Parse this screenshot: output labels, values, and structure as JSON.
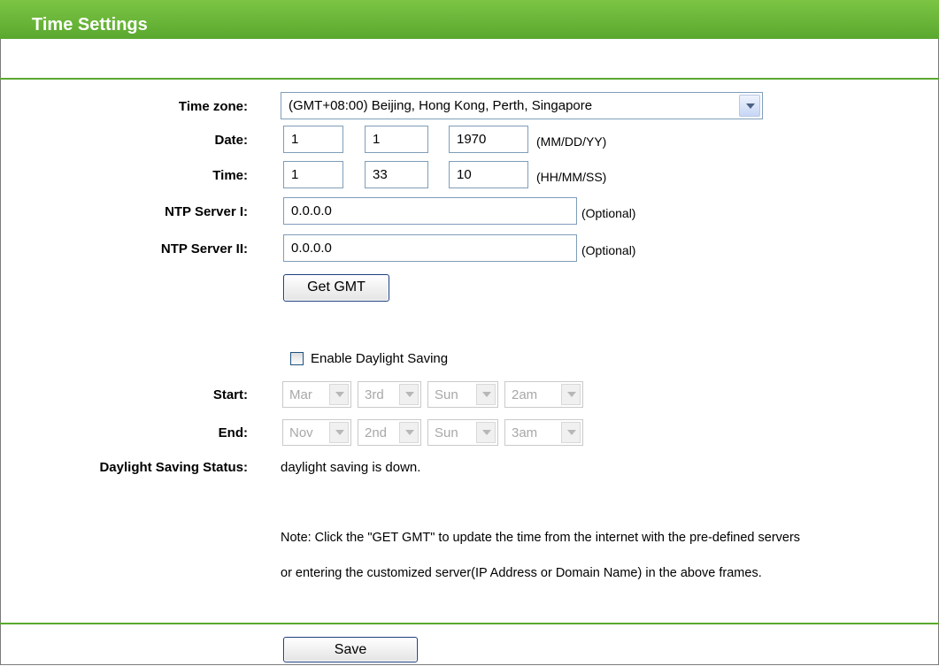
{
  "title": "Time Settings",
  "labels": {
    "time_zone": "Time zone:",
    "date": "Date:",
    "time": "Time:",
    "ntp1": "NTP Server I:",
    "ntp2": "NTP Server II:",
    "start": "Start:",
    "end": "End:",
    "dst_status": "Daylight Saving Status:"
  },
  "time_zone": {
    "selected": "(GMT+08:00) Beijing, Hong Kong, Perth, Singapore"
  },
  "date": {
    "month": "1",
    "day": "1",
    "year": "1970",
    "format": "(MM/DD/YY)"
  },
  "time": {
    "hour": "1",
    "minute": "33",
    "second": "10",
    "format": "(HH/MM/SS)"
  },
  "ntp1": {
    "value": "0.0.0.0",
    "hint": "(Optional)"
  },
  "ntp2": {
    "value": "0.0.0.0",
    "hint": "(Optional)"
  },
  "get_gmt_label": "Get GMT",
  "daylight": {
    "checkbox_label": "Enable Daylight Saving",
    "checked": false,
    "start": {
      "month": "Mar",
      "week": "3rd",
      "day": "Sun",
      "hour": "2am"
    },
    "end": {
      "month": "Nov",
      "week": "2nd",
      "day": "Sun",
      "hour": "3am"
    },
    "status": "daylight saving is down."
  },
  "note_line1": "Note: Click the \"GET GMT\" to update the time from the internet with the pre-defined servers",
  "note_line2": "or entering the customized server(IP Address or Domain Name) in the above frames.",
  "save_label": "Save",
  "colors": {
    "header_green": "#6cb83f",
    "rule_green": "#5aa82f"
  }
}
